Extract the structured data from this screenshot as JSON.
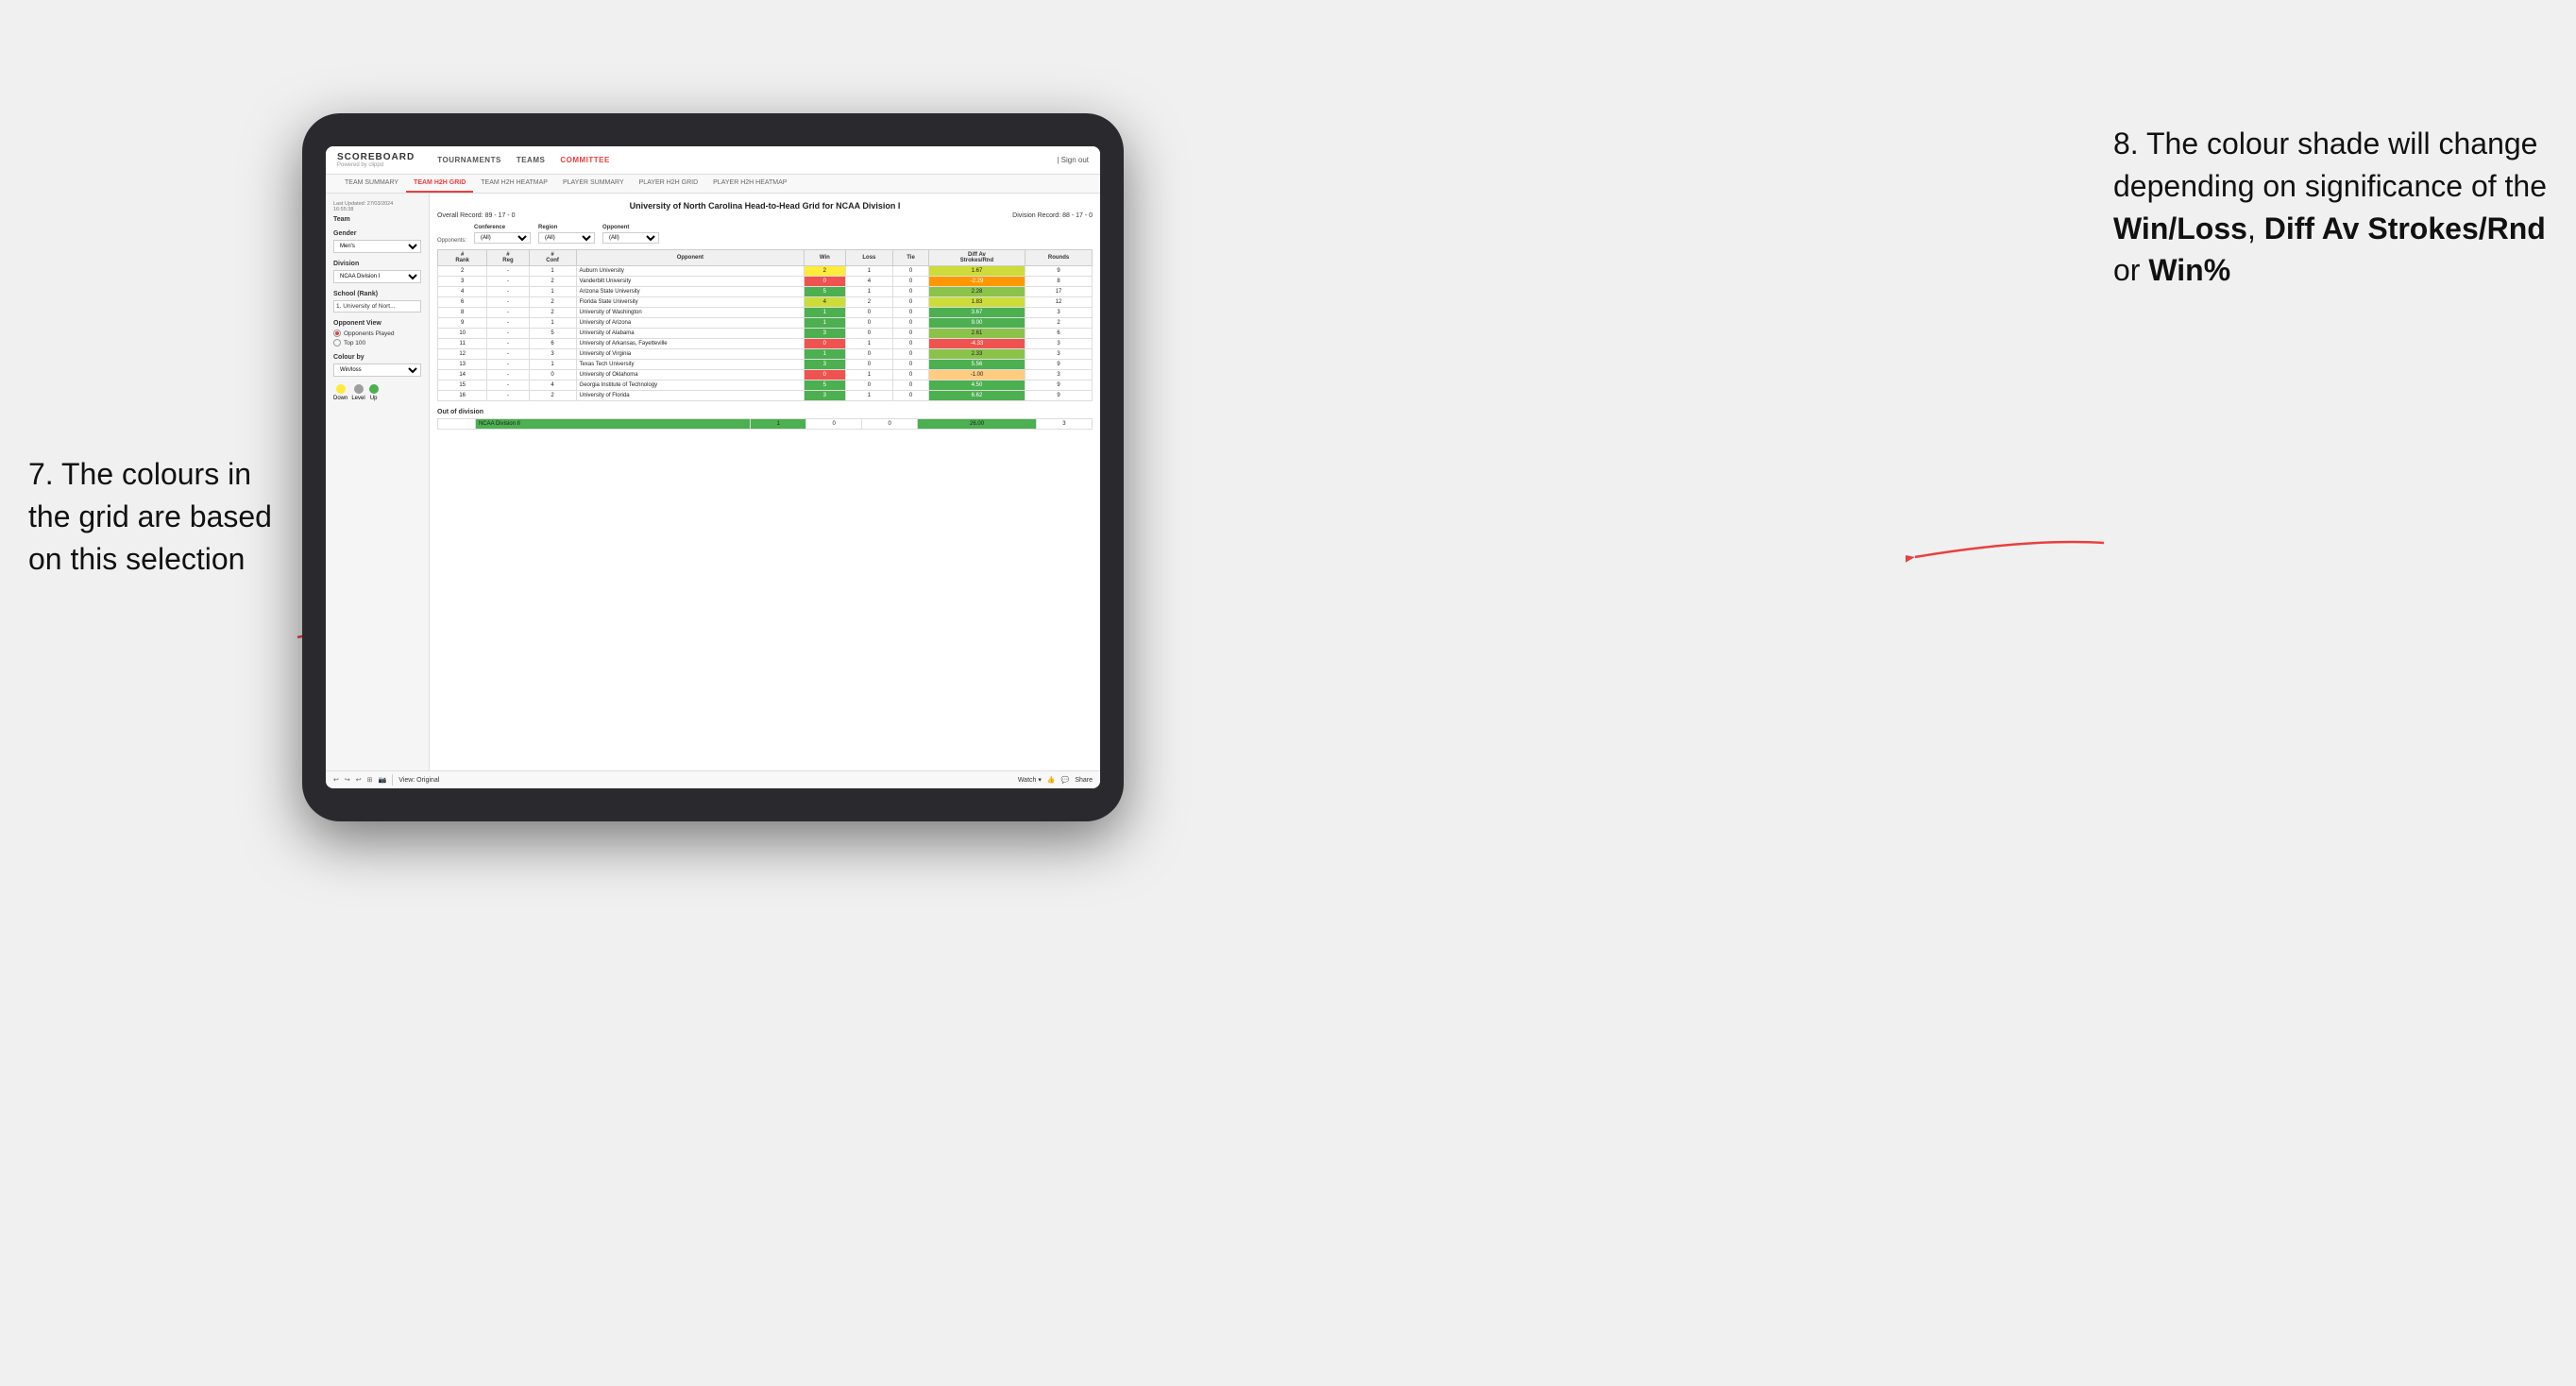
{
  "annotations": {
    "left": {
      "number": "7.",
      "text": "The colours in the grid are based on this selection"
    },
    "right": {
      "number": "8.",
      "text": "The colour shade will change depending on significance of the ",
      "bold1": "Win/Loss",
      "sep1": ", ",
      "bold2": "Diff Av Strokes/Rnd",
      "sep2": " or ",
      "bold3": "Win%"
    }
  },
  "nav": {
    "logo": "SCOREBOARD",
    "logo_sub": "Powered by clippd",
    "items": [
      "TOURNAMENTS",
      "TEAMS",
      "COMMITTEE"
    ],
    "sign_out": "| Sign out"
  },
  "sub_nav": {
    "items": [
      "TEAM SUMMARY",
      "TEAM H2H GRID",
      "TEAM H2H HEATMAP",
      "PLAYER SUMMARY",
      "PLAYER H2H GRID",
      "PLAYER H2H HEATMAP"
    ],
    "active": "TEAM H2H GRID"
  },
  "sidebar": {
    "last_updated_label": "Last Updated: 27/03/2024",
    "last_updated_time": "16:55:38",
    "team_label": "Team",
    "gender_label": "Gender",
    "gender_value": "Men's",
    "division_label": "Division",
    "division_value": "NCAA Division I",
    "school_label": "School (Rank)",
    "school_value": "1. University of Nort...",
    "opponent_view_label": "Opponent View",
    "radio_items": [
      "Opponents Played",
      "Top 100"
    ],
    "radio_selected": "Opponents Played",
    "colour_by_label": "Colour by",
    "colour_by_value": "Win/loss",
    "legend": [
      {
        "label": "Down",
        "color": "#ffeb3b"
      },
      {
        "label": "Level",
        "color": "#9e9e9e"
      },
      {
        "label": "Up",
        "color": "#4caf50"
      }
    ]
  },
  "grid": {
    "title": "University of North Carolina Head-to-Head Grid for NCAA Division I",
    "overall_record": "Overall Record: 89 - 17 - 0",
    "division_record": "Division Record: 88 - 17 - 0",
    "filter_conference_label": "Conference",
    "filter_region_label": "Region",
    "filter_opponent_label": "Opponent",
    "opponents_label": "Opponents:",
    "opponents_value": "(All)",
    "columns": [
      "#Rank",
      "#Reg",
      "#Conf",
      "Opponent",
      "Win",
      "Loss",
      "Tie",
      "Diff Av Strokes/Rnd",
      "Rounds"
    ],
    "rows": [
      {
        "rank": "2",
        "reg": "-",
        "conf": "1",
        "opponent": "Auburn University",
        "win": "2",
        "loss": "1",
        "tie": "0",
        "diff": "1.67",
        "rounds": "9",
        "win_color": "yellow",
        "diff_color": "green_light"
      },
      {
        "rank": "3",
        "reg": "-",
        "conf": "2",
        "opponent": "Vanderbilt University",
        "win": "0",
        "loss": "4",
        "tie": "0",
        "diff": "-2.29",
        "rounds": "8",
        "win_color": "red",
        "diff_color": "orange"
      },
      {
        "rank": "4",
        "reg": "-",
        "conf": "1",
        "opponent": "Arizona State University",
        "win": "5",
        "loss": "1",
        "tie": "0",
        "diff": "2.28",
        "rounds": "17",
        "win_color": "green_dark",
        "diff_color": "green_med"
      },
      {
        "rank": "6",
        "reg": "-",
        "conf": "2",
        "opponent": "Florida State University",
        "win": "4",
        "loss": "2",
        "tie": "0",
        "diff": "1.83",
        "rounds": "12",
        "win_color": "green_light",
        "diff_color": "green_light"
      },
      {
        "rank": "8",
        "reg": "-",
        "conf": "2",
        "opponent": "University of Washington",
        "win": "1",
        "loss": "0",
        "tie": "0",
        "diff": "3.67",
        "rounds": "3",
        "win_color": "green_dark",
        "diff_color": "green_dark"
      },
      {
        "rank": "9",
        "reg": "-",
        "conf": "1",
        "opponent": "University of Arizona",
        "win": "1",
        "loss": "0",
        "tie": "0",
        "diff": "9.00",
        "rounds": "2",
        "win_color": "green_dark",
        "diff_color": "green_dark"
      },
      {
        "rank": "10",
        "reg": "-",
        "conf": "5",
        "opponent": "University of Alabama",
        "win": "3",
        "loss": "0",
        "tie": "0",
        "diff": "2.61",
        "rounds": "6",
        "win_color": "green_dark",
        "diff_color": "green_med"
      },
      {
        "rank": "11",
        "reg": "-",
        "conf": "6",
        "opponent": "University of Arkansas, Fayetteville",
        "win": "0",
        "loss": "1",
        "tie": "0",
        "diff": "-4.33",
        "rounds": "3",
        "win_color": "red",
        "diff_color": "red"
      },
      {
        "rank": "12",
        "reg": "-",
        "conf": "3",
        "opponent": "University of Virginia",
        "win": "1",
        "loss": "0",
        "tie": "0",
        "diff": "2.33",
        "rounds": "3",
        "win_color": "green_dark",
        "diff_color": "green_med"
      },
      {
        "rank": "13",
        "reg": "-",
        "conf": "1",
        "opponent": "Texas Tech University",
        "win": "3",
        "loss": "0",
        "tie": "0",
        "diff": "5.56",
        "rounds": "9",
        "win_color": "green_dark",
        "diff_color": "green_dark"
      },
      {
        "rank": "14",
        "reg": "-",
        "conf": "0",
        "opponent": "University of Oklahoma",
        "win": "0",
        "loss": "1",
        "tie": "0",
        "diff": "-1.00",
        "rounds": "3",
        "win_color": "red",
        "diff_color": "orange_light"
      },
      {
        "rank": "15",
        "reg": "-",
        "conf": "4",
        "opponent": "Georgia Institute of Technology",
        "win": "5",
        "loss": "0",
        "tie": "0",
        "diff": "4.50",
        "rounds": "9",
        "win_color": "green_dark",
        "diff_color": "green_dark"
      },
      {
        "rank": "16",
        "reg": "-",
        "conf": "2",
        "opponent": "University of Florida",
        "win": "3",
        "loss": "1",
        "tie": "0",
        "diff": "6.62",
        "rounds": "9",
        "win_color": "green_dark",
        "diff_color": "green_dark"
      }
    ],
    "out_of_division_title": "Out of division",
    "out_of_division_rows": [
      {
        "label": "NCAA Division II",
        "win": "1",
        "loss": "0",
        "tie": "0",
        "diff": "26.00",
        "rounds": "3",
        "win_color": "green_dark",
        "diff_color": "green_dark"
      }
    ]
  },
  "toolbar": {
    "view_label": "View: Original",
    "watch_label": "Watch ▾",
    "share_label": "Share"
  }
}
